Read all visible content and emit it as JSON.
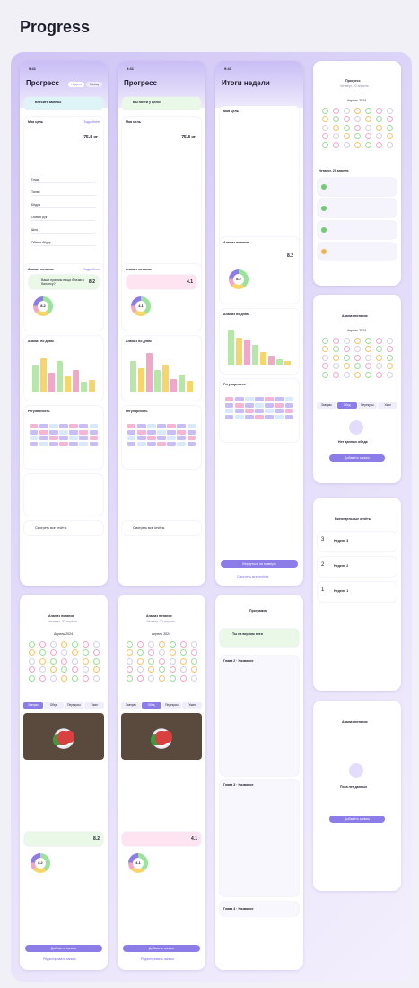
{
  "page_title": "Progress",
  "time": "9:41",
  "screens": {
    "p1": {
      "title": "Прогресс",
      "banner": "Внесите замеры",
      "tab1": "Неделя",
      "tab2": "Месяц"
    },
    "p2": {
      "title": "Прогресс",
      "banner": "Вы почти у цели!"
    },
    "p3": {
      "title": "Итоги недели"
    },
    "p4": {
      "title": "Прогресс",
      "subtitle": "Четверг, 20 апреля",
      "month": "Апрель 2024",
      "day_title": "Четверг, 20 апреля"
    },
    "p5": {
      "title": "Анализ питания",
      "month": "Апрель 2024",
      "empty": "Нет данных обеда",
      "button": "Добавить запись"
    },
    "p6": {
      "title": "Еженедельные отчёты",
      "items": [
        "Неделя 3",
        "Неделя 2",
        "Неделя 1"
      ],
      "nums": [
        "3",
        "2",
        "1"
      ]
    },
    "p7": {
      "title": "Анализ питания",
      "empty": "Пока нет данных",
      "button": "Добавить запись"
    },
    "p8": {
      "title": "Анализ питания",
      "subtitle": "Четверг, 20 апреля",
      "month": "Апрель 2024",
      "add": "Добавить запись",
      "edit": "Редактировать запись",
      "score": "8.2"
    },
    "p9": {
      "title": "Анализ питания",
      "subtitle": "Четверг, 20 апреля",
      "month": "Апрель 2024",
      "add": "Добавить запись",
      "edit": "Редактировать запись",
      "score": "4.1"
    },
    "p10": {
      "title": "Программа",
      "banner": "Ты на верном пути",
      "group1": "Глава 2 · Название",
      "group2": "Глава 3 · Название",
      "group3": "Глава 4 · Название"
    }
  },
  "labels": {
    "my_goal": "Моя цель",
    "details": "Подробнее",
    "weight": "75.8 кг",
    "nutrition": "Анализ питания",
    "meal_q": "Ваши приемы пищи близки к балансу?",
    "score": "8.2",
    "score2": "4.1",
    "diary": "Анализ по дням",
    "regularity": "Регулярность",
    "report": "Смотреть все отчёты",
    "enter": "Внести замеры",
    "back": "Вернуться на главную",
    "all_reports": "Смотреть все отчёты",
    "meals": [
      "Завтрак",
      "Обед",
      "Перекусы",
      "Ужин"
    ],
    "rows": [
      "Грудь",
      "Талия",
      "Бёдра",
      "Обхват рук",
      "Шея",
      "Обхват бёдер"
    ]
  },
  "chart_bars_1": [
    0.62,
    0.78,
    0.44,
    0.7,
    0.35,
    0.5,
    0.22,
    0.28
  ],
  "chart_bars_2": [
    0.7,
    0.55,
    0.9,
    0.5,
    0.62,
    0.3,
    0.4,
    0.24
  ],
  "chart_bars_3": [
    0.82,
    0.62,
    0.58,
    0.46,
    0.3,
    0.2,
    0.12,
    0.08
  ],
  "colors": {
    "accent": "#8b7ce8",
    "green": "#9be39b",
    "yellow": "#f6d66b",
    "pink": "#f1a7c8"
  }
}
